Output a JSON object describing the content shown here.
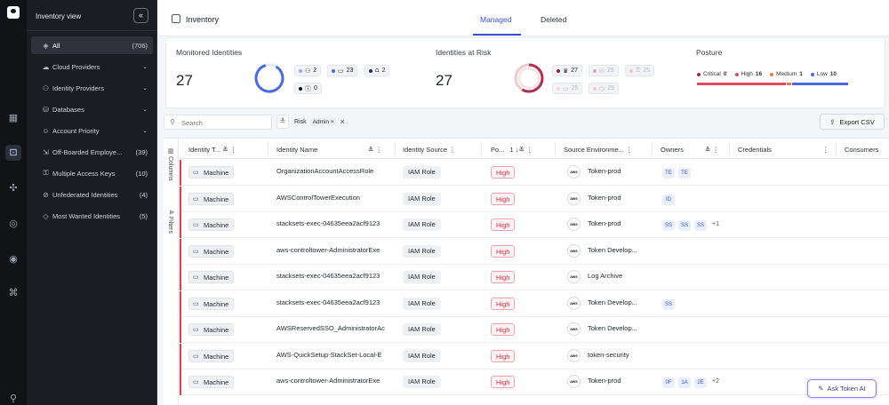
{
  "sidebar": {
    "title": "Inventory view",
    "items": [
      {
        "label": "All",
        "count": "(706)",
        "icon": "layers-icon"
      },
      {
        "label": "Cloud Providers",
        "icon": "cloud-icon"
      },
      {
        "label": "Identity Providers",
        "icon": "user-icon"
      },
      {
        "label": "Databases",
        "icon": "database-icon"
      },
      {
        "label": "Account Priority",
        "icon": "person-icon"
      },
      {
        "label": "Off-Boarded Employe...",
        "count": "(39)",
        "icon": "offboard-icon"
      },
      {
        "label": "Multiple Access Keys",
        "count": "(10)",
        "icon": "key-icon"
      },
      {
        "label": "Unfederated Identities",
        "count": "(4)",
        "icon": "user-x-icon"
      },
      {
        "label": "Most Wanted Identities",
        "count": "(5)",
        "icon": "diamond-icon"
      }
    ]
  },
  "header": {
    "title": "Inventory",
    "tabs": [
      "Managed",
      "Deleted"
    ]
  },
  "summary": {
    "monitored": {
      "label": "Monitored Identities",
      "value": "27",
      "chips": [
        "2",
        "23",
        "2",
        "0"
      ]
    },
    "at_risk": {
      "label": "Identities at Risk",
      "value": "27",
      "chips": [
        "27",
        "25",
        "25",
        "25",
        "25"
      ]
    },
    "posture": {
      "label": "Posture",
      "legend": [
        {
          "label": "Critical",
          "value": "0",
          "color": "#b0263a"
        },
        {
          "label": "High",
          "value": "16",
          "color": "#e04a5a"
        },
        {
          "label": "Medium",
          "value": "1",
          "color": "#e8754a"
        },
        {
          "label": "Low",
          "value": "10",
          "color": "#4a68e0"
        }
      ]
    }
  },
  "toolbar": {
    "search_placeholder": "Search",
    "filter_label": "Risk",
    "filter_tag": "Admin",
    "export_label": "Export CSV"
  },
  "side_tabs": [
    "Columns",
    "Filters"
  ],
  "columns": [
    "Identity T...",
    "Identity Name",
    "Identity Source",
    "Po...",
    "1",
    "Source Environme...",
    "Owners",
    "Credentials",
    "Consumers"
  ],
  "rows": [
    {
      "type": "Machine",
      "name": "OrganizationAccountAccessRole",
      "source": "IAM Role",
      "posture": "High",
      "env": "Token-prod",
      "owners": [
        "TE",
        "TE"
      ],
      "more": ""
    },
    {
      "type": "Machine",
      "name": "AWSControlTowerExecution",
      "source": "IAM Role",
      "posture": "High",
      "env": "Token-prod",
      "owners": [
        "ID"
      ],
      "more": ""
    },
    {
      "type": "Machine",
      "name": "stacksets-exec-04635eea2acf9123",
      "source": "IAM Role",
      "posture": "High",
      "env": "Token-prod",
      "owners": [
        "SS",
        "SS",
        "SS"
      ],
      "more": "+1"
    },
    {
      "type": "Machine",
      "name": "aws-controltower-AdministratorExe",
      "source": "IAM Role",
      "posture": "High",
      "env": "Token Develop...",
      "owners": [],
      "more": ""
    },
    {
      "type": "Machine",
      "name": "stacksets-exec-04635eea2acf9123",
      "source": "IAM Role",
      "posture": "High",
      "env": "Log Archive",
      "owners": [],
      "more": ""
    },
    {
      "type": "Machine",
      "name": "stacksets-exec-04635eea2acf9123",
      "source": "IAM Role",
      "posture": "High",
      "env": "Token Develop...",
      "owners": [
        "SS"
      ],
      "more": ""
    },
    {
      "type": "Machine",
      "name": "AWSReservedSSO_AdministratorAc",
      "source": "IAM Role",
      "posture": "High",
      "env": "Token Develop...",
      "owners": [],
      "more": ""
    },
    {
      "type": "Machine",
      "name": "AWS-QuickSetup-StackSet-Local-E",
      "source": "IAM Role",
      "posture": "High",
      "env": "token-security",
      "owners": [],
      "more": ""
    },
    {
      "type": "Machine",
      "name": "aws-controltower-AdministratorExe",
      "source": "IAM Role",
      "posture": "High",
      "env": "Token-prod",
      "owners": [
        "0F",
        "1A",
        "2E"
      ],
      "more": "+2"
    }
  ],
  "env_logo": "aws",
  "ask_button": "Ask Token AI"
}
